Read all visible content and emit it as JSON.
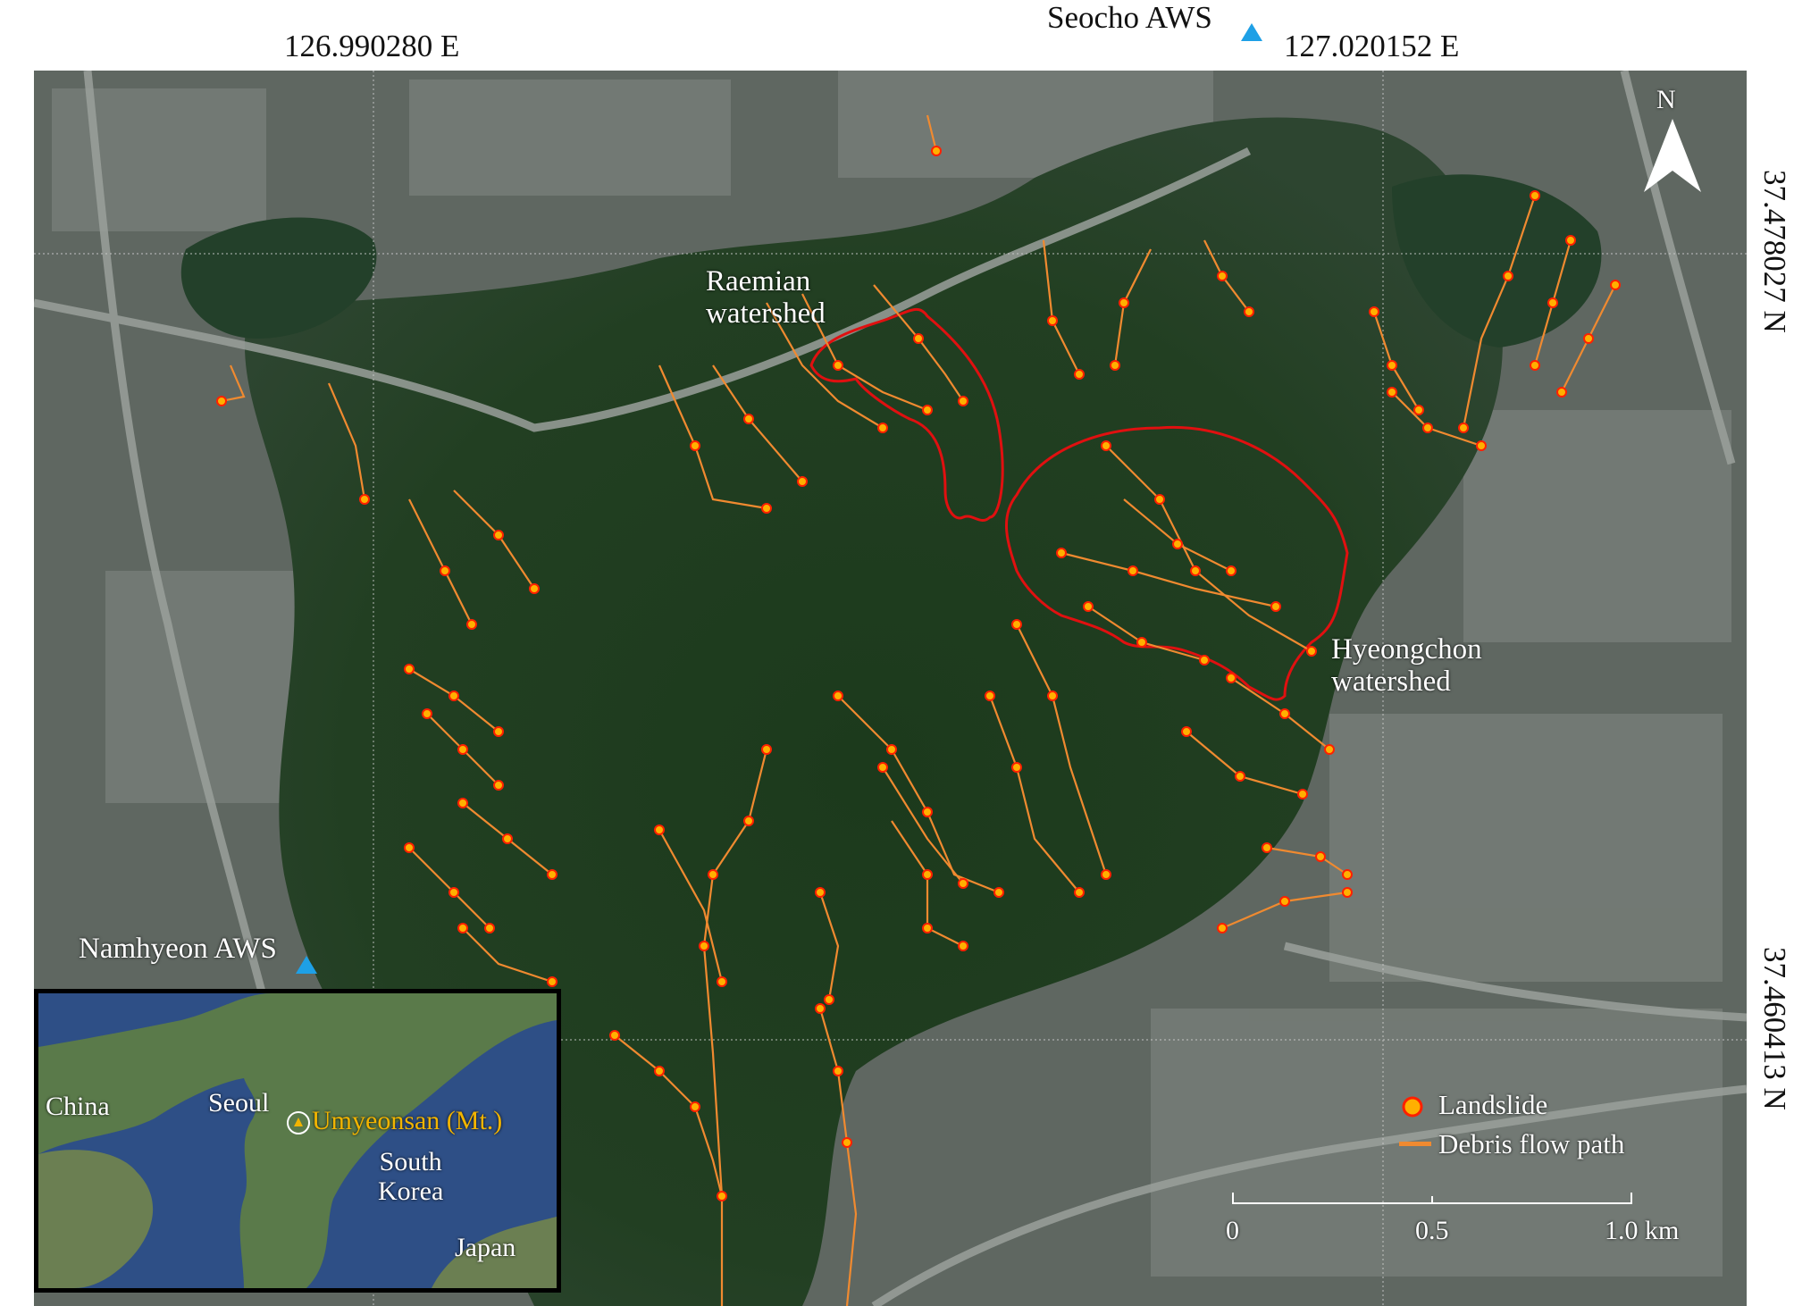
{
  "figure": {
    "coords": {
      "lon_left": "126.990280 E",
      "lon_right": "127.020152 E",
      "lat_top": "37.478027 N",
      "lat_bottom": "37.460413 N"
    },
    "stations": {
      "seocho": "Seocho AWS",
      "namhyeon": "Namhyeon AWS"
    },
    "watersheds": {
      "raemian_line1": "Raemian",
      "raemian_line2": "watershed",
      "hyeongchon_line1": "Hyeongchon",
      "hyeongchon_line2": "watershed"
    },
    "north": "N",
    "legend": {
      "landslide": "Landslide",
      "debris": "Debris flow path"
    },
    "scale": {
      "zero": "0",
      "half": "0.5",
      "one": "1.0 km"
    },
    "inset": {
      "china": "China",
      "seoul": "Seoul",
      "mountain": "Umyeonsan (Mt.)",
      "south_korea_1": "South",
      "south_korea_2": "Korea",
      "japan": "Japan"
    },
    "colors": {
      "watershed_boundary": "#e01010",
      "debris_path": "#f08a30",
      "landslide_fill": "#ffb000",
      "landslide_edge": "#ff2000",
      "station_marker": "#1ea0e6",
      "mountain_label": "#f2b400"
    }
  }
}
